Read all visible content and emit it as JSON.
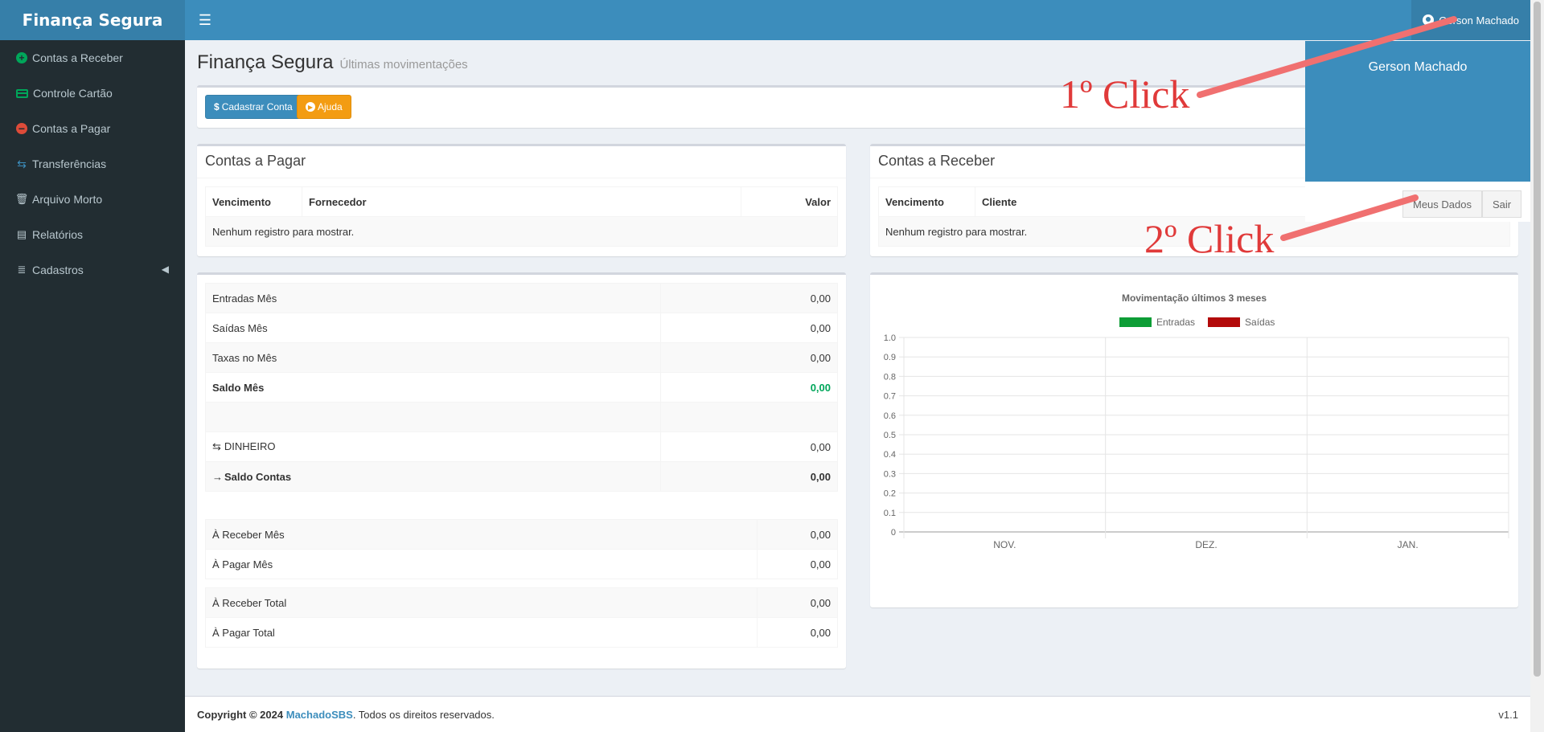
{
  "header": {
    "logo": "Finança Segura",
    "menu_icon": "hamburger-icon",
    "user_name": "Gerson Machado"
  },
  "sidebar": {
    "items": [
      {
        "label": "Contas a Receber",
        "icon": "plus-circle-icon"
      },
      {
        "label": "Controle Cartão",
        "icon": "credit-card-icon"
      },
      {
        "label": "Contas a Pagar",
        "icon": "minus-circle-icon"
      },
      {
        "label": "Transferências",
        "icon": "transfer-icon"
      },
      {
        "label": "Arquivo Morto",
        "icon": "trash-icon"
      },
      {
        "label": "Relatórios",
        "icon": "file-icon"
      },
      {
        "label": "Cadastros",
        "icon": "database-icon"
      }
    ]
  },
  "page": {
    "title": "Finança Segura",
    "subtitle": "Últimas movimentações"
  },
  "toolbar": {
    "cadastrar_label": "Cadastrar Conta",
    "ajuda_label": "Ajuda"
  },
  "pagar": {
    "title": "Contas a Pagar",
    "col_vencimento": "Vencimento",
    "col_fornecedor": "Fornecedor",
    "col_valor": "Valor",
    "empty": "Nenhum registro para mostrar."
  },
  "receber": {
    "title": "Contas a Receber",
    "col_vencimento": "Vencimento",
    "col_cliente": "Cliente",
    "empty": "Nenhum registro para mostrar."
  },
  "summary": {
    "entradas_label": "Entradas Mês",
    "entradas_value": "0,00",
    "saidas_label": "Saídas Mês",
    "saidas_value": "0,00",
    "taxas_label": "Taxas no Mês",
    "taxas_value": "0,00",
    "saldo_label": "Saldo Mês",
    "saldo_value": "0,00",
    "dinheiro_label": "DINHEIRO",
    "dinheiro_value": "0,00",
    "saldo_contas_label": "Saldo Contas",
    "saldo_contas_value": "0,00",
    "receber_mes_label": "À Receber Mês",
    "receber_mes_value": "0,00",
    "pagar_mes_label": "À Pagar Mês",
    "pagar_mes_value": "0,00",
    "receber_total_label": "À Receber Total",
    "receber_total_value": "0,00",
    "pagar_total_label": "À Pagar Total",
    "pagar_total_value": "0,00"
  },
  "chart_data": {
    "type": "bar",
    "title": "Movimentação últimos 3 meses",
    "categories": [
      "NOV.",
      "DEZ.",
      "JAN."
    ],
    "series": [
      {
        "name": "Entradas",
        "values": [
          0,
          0,
          0
        ],
        "color": "#0d9d36"
      },
      {
        "name": "Saídas",
        "values": [
          0,
          0,
          0
        ],
        "color": "#b30a0a"
      }
    ],
    "yticks": [
      "1.0",
      "0.9",
      "0.8",
      "0.7",
      "0.6",
      "0.5",
      "0.4",
      "0.3",
      "0.2",
      "0.1",
      "0"
    ],
    "ylim": [
      0,
      1
    ],
    "grid": true,
    "legend": "top"
  },
  "dropdown": {
    "user_name": "Gerson Machado",
    "meus_dados_label": "Meus Dados",
    "sair_label": "Sair"
  },
  "annotations": {
    "first": "1º Click",
    "second": "2º Click",
    "color": "#e03a3a"
  },
  "footer": {
    "copyright_prefix": "Copyright © 2024",
    "company": "MachadoSBS",
    "suffix": ". Todos os direitos reservados.",
    "version": "v1.1"
  }
}
